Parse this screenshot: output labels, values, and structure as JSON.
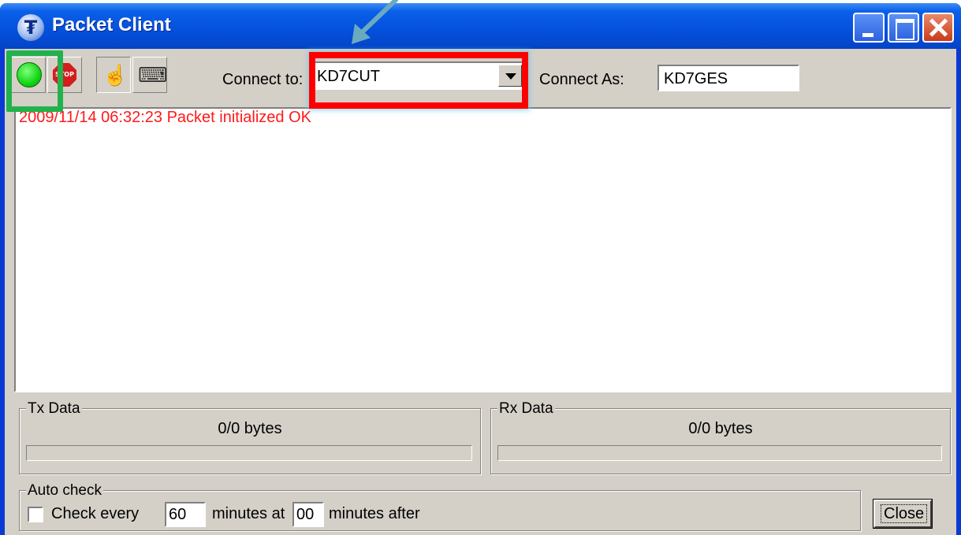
{
  "window": {
    "title": "Packet Client",
    "app_icon_glyph": "₮"
  },
  "toolbar": {
    "connect_to_label": "Connect to:",
    "connect_to_value": "KD7CUT",
    "connect_as_label": "Connect As:",
    "connect_as_value": "KD7GES",
    "icons": [
      "connect-go-icon",
      "stop-icon",
      "hand-pointer-icon",
      "keyboard-icon"
    ]
  },
  "log": {
    "lines": [
      "2009/11/14 06:32:23 Packet initialized OK"
    ]
  },
  "tx": {
    "title": "Tx Data",
    "bytes": "0/0 bytes",
    "progress": 0
  },
  "rx": {
    "title": "Rx Data",
    "bytes": "0/0 bytes",
    "progress": 0
  },
  "auto_check": {
    "title": "Auto check",
    "check_label": "Check every",
    "every_value": "60",
    "minutes_at_label": "minutes at",
    "after_value": "00",
    "after_label": "minutes after",
    "checked": false
  },
  "buttons": {
    "close_label": "Close"
  },
  "colors": {
    "log_text": "#ff1a1a",
    "highlight_green": "#22b24c",
    "highlight_red": "#ff0000",
    "arrow": "#6aaac0"
  }
}
